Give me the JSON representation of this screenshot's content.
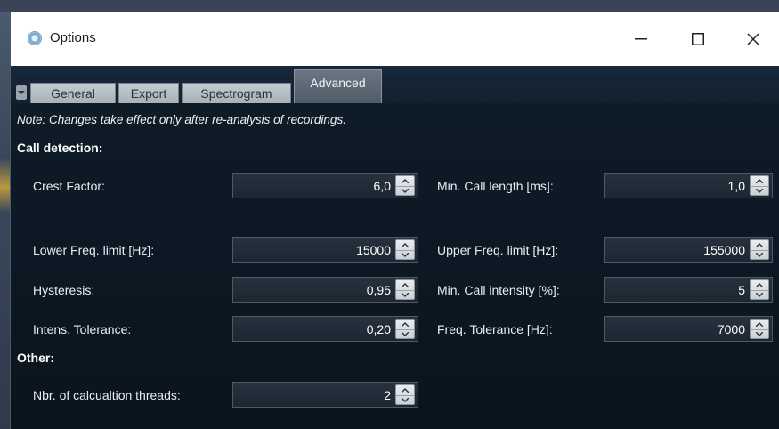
{
  "window": {
    "title": "Options",
    "controls": {
      "minimize": "–",
      "maximize": "☐",
      "close": "✕"
    }
  },
  "tabs": [
    {
      "label": "General",
      "active": false
    },
    {
      "label": "Export",
      "active": false
    },
    {
      "label": "Spectrogram",
      "active": false
    },
    {
      "label": "Advanced",
      "active": true
    }
  ],
  "note": "Note: Changes take effect only after re-analysis of recordings.",
  "call_detection": {
    "heading": "Call detection:",
    "left": [
      {
        "label": "Crest Factor:",
        "value": "6,0"
      },
      {
        "label": "Lower Freq. limit [Hz]:",
        "value": "15000"
      },
      {
        "label": "Hysteresis:",
        "value": "0,95"
      },
      {
        "label": "Intens. Tolerance:",
        "value": "0,20"
      }
    ],
    "right": [
      {
        "label": "Min. Call length [ms]:",
        "value": "1,0"
      },
      {
        "label": "Upper Freq. limit [Hz]:",
        "value": "155000"
      },
      {
        "label": "Min. Call intensity [%]:",
        "value": "5"
      },
      {
        "label": "Freq. Tolerance [Hz]:",
        "value": "7000"
      }
    ]
  },
  "other": {
    "heading": "Other:",
    "threads": {
      "label": "Nbr. of calcualtion threads:",
      "value": "2"
    }
  },
  "icons": {
    "app": "options-gear-icon",
    "spin_up": "chevron-up-icon",
    "spin_down": "chevron-down-icon",
    "tab_menu": "tab-menu-icon"
  },
  "colors": {
    "panel_bg": "#0f1e2b",
    "titlebar_bg": "#ffffff",
    "active_tab": "#5d6975",
    "inactive_tab": "#b6bec5",
    "field_bg": "#222d38"
  }
}
